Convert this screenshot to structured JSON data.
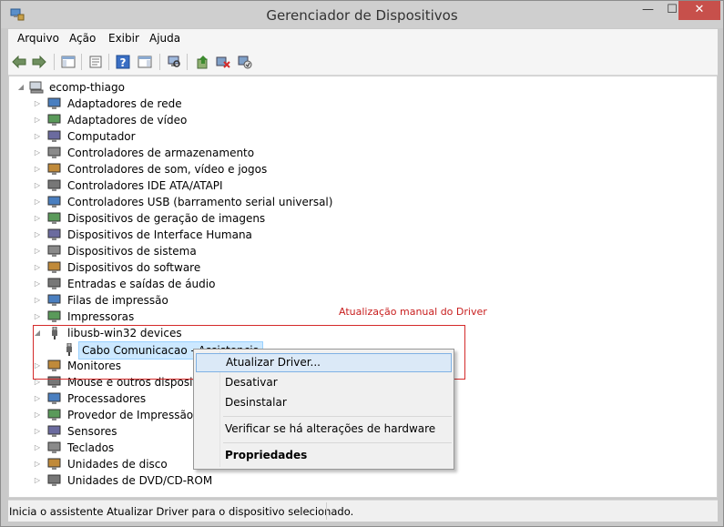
{
  "window": {
    "title": "Gerenciador de Dispositivos",
    "minimize_glyph": "—",
    "maximize_glyph": "☐",
    "close_glyph": "✕"
  },
  "menubar": {
    "items": [
      {
        "label": "Arquivo"
      },
      {
        "label": "Ação"
      },
      {
        "label": "Exibir"
      },
      {
        "label": "Ajuda"
      }
    ]
  },
  "toolbar": {
    "buttons": [
      {
        "icon": "back-arrow-icon"
      },
      {
        "icon": "forward-arrow-icon"
      },
      {
        "icon": "console-tree-icon"
      },
      {
        "icon": "properties-icon"
      },
      {
        "icon": "help-icon"
      },
      {
        "icon": "action-pane-icon"
      },
      {
        "icon": "scan-hardware-icon"
      },
      {
        "icon": "update-driver-icon"
      },
      {
        "icon": "uninstall-icon"
      },
      {
        "icon": "enable-device-icon"
      }
    ]
  },
  "tree": {
    "root": "ecomp-thiago",
    "items": [
      {
        "label": "Adaptadores de rede",
        "icon": "network-adapter-icon"
      },
      {
        "label": "Adaptadores de vídeo",
        "icon": "display-adapter-icon"
      },
      {
        "label": "Computador",
        "icon": "computer-icon"
      },
      {
        "label": "Controladores de armazenamento",
        "icon": "storage-controller-icon"
      },
      {
        "label": "Controladores de som, vídeo e jogos",
        "icon": "sound-controller-icon"
      },
      {
        "label": "Controladores IDE ATA/ATAPI",
        "icon": "ide-controller-icon"
      },
      {
        "label": "Controladores USB (barramento serial universal)",
        "icon": "usb-controller-icon"
      },
      {
        "label": "Dispositivos de geração de imagens",
        "icon": "imaging-device-icon"
      },
      {
        "label": "Dispositivos de Interface Humana",
        "icon": "hid-icon"
      },
      {
        "label": "Dispositivos de sistema",
        "icon": "system-device-icon"
      },
      {
        "label": "Dispositivos do software",
        "icon": "software-device-icon"
      },
      {
        "label": "Entradas e saídas de áudio",
        "icon": "audio-io-icon"
      },
      {
        "label": "Filas de impressão",
        "icon": "print-queue-icon"
      },
      {
        "label": "Impressoras",
        "icon": "printer-icon"
      },
      {
        "label": "libusb-win32 devices",
        "icon": "usb-plug-icon",
        "expanded": true
      },
      {
        "label": "Cabo Comunicacao - Assistencia",
        "icon": "usb-plug-icon",
        "child": true,
        "selected": true
      },
      {
        "label": "Monitores",
        "icon": "monitor-icon"
      },
      {
        "label": "Mouse e outros dispositivo",
        "icon": "mouse-icon"
      },
      {
        "label": "Processadores",
        "icon": "processor-icon"
      },
      {
        "label": "Provedor de Impressão WS",
        "icon": "ws-print-provider-icon"
      },
      {
        "label": "Sensores",
        "icon": "sensor-icon"
      },
      {
        "label": "Teclados",
        "icon": "keyboard-icon"
      },
      {
        "label": "Unidades de disco",
        "icon": "disk-drive-icon"
      },
      {
        "label": "Unidades de DVD/CD-ROM",
        "icon": "dvd-drive-icon"
      }
    ]
  },
  "annotation": {
    "text": "Atualização manual do Driver",
    "color": "#d42a2a"
  },
  "context_menu": {
    "items": [
      {
        "label": "Atualizar Driver...",
        "highlighted": true
      },
      {
        "label": "Desativar"
      },
      {
        "label": "Desinstalar"
      },
      {
        "label": "Verificar se há alterações de hardware"
      },
      {
        "label": "Propriedades",
        "bold": true
      }
    ]
  },
  "statusbar": {
    "text": "Inicia o assistente Atualizar Driver para o dispositivo selecionado."
  },
  "colors": {
    "selection": "#cce8ff",
    "menu_highlight": "#dbe9f7",
    "close_button": "#c7504b"
  }
}
